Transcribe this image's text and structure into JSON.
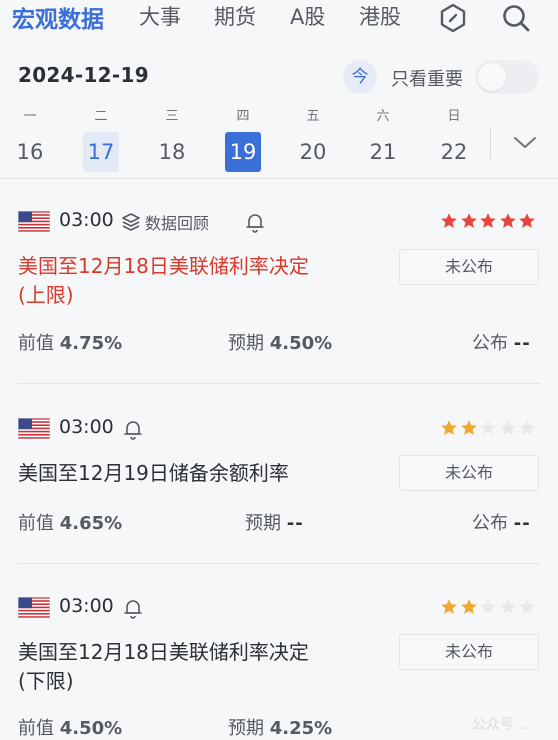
{
  "nav": {
    "tabs": [
      {
        "label": "宏观数据",
        "active": true
      },
      {
        "label": "大事"
      },
      {
        "label": "期货"
      },
      {
        "label": "A股"
      },
      {
        "label": "港股"
      }
    ],
    "icons": [
      "hexagon-icon",
      "search-icon"
    ]
  },
  "date_bar": {
    "date": "2024-12-19",
    "today_label": "今",
    "important_only_label": "只看重要",
    "important_only": false
  },
  "week": [
    {
      "weekday": "一",
      "day": "16"
    },
    {
      "weekday": "二",
      "day": "17",
      "state": "previous"
    },
    {
      "weekday": "三",
      "day": "18"
    },
    {
      "weekday": "四",
      "day": "19",
      "state": "selected"
    },
    {
      "weekday": "五",
      "day": "20"
    },
    {
      "weekday": "六",
      "day": "21"
    },
    {
      "weekday": "日",
      "day": "22"
    }
  ],
  "events": [
    {
      "time": "03:00",
      "review_label": "数据回顾",
      "stars": 5,
      "star_color": "#e8453c",
      "title_line1": "美国至12月18日美联储利率决定",
      "title_line2": "(上限)",
      "status": "未公布",
      "prev_label": "前值",
      "prev_value": "4.75%",
      "forecast_label": "预期",
      "forecast_value": "4.50%",
      "actual_label": "公布",
      "actual_value": "--"
    },
    {
      "time": "03:00",
      "stars": 2,
      "star_color": "#f0a830",
      "title_line1": "美国至12月19日储备余额利率",
      "status": "未公布",
      "prev_label": "前值",
      "prev_value": "4.65%",
      "forecast_label": "预期",
      "forecast_value": "--",
      "actual_label": "公布",
      "actual_value": "--"
    },
    {
      "time": "03:00",
      "stars": 2,
      "star_color": "#f0a830",
      "title_line1": "美国至12月18日美联储利率决定",
      "title_line2": "(下限)",
      "status": "未公布",
      "prev_label": "前值",
      "prev_value": "4.50%",
      "forecast_label": "预期",
      "forecast_value": "4.25%"
    }
  ],
  "colors": {
    "accent": "#3a6fd8",
    "important_title": "#d9392b",
    "star_empty": "#e6e8eb"
  },
  "watermark": "公众号..."
}
